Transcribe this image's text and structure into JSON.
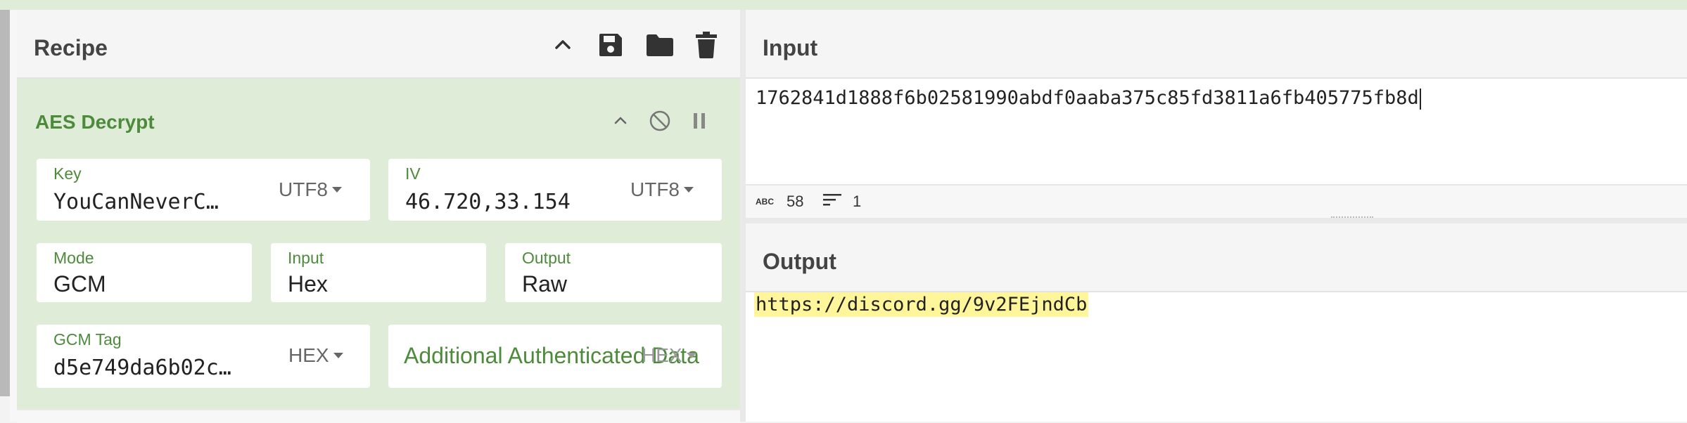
{
  "recipe": {
    "title": "Recipe",
    "icons": [
      "chevron-up-icon",
      "save-icon",
      "folder-icon",
      "trash-icon"
    ]
  },
  "operation": {
    "title": "AES Decrypt",
    "key": {
      "label": "Key",
      "value": "YouCanNeverC…",
      "encoding": "UTF8"
    },
    "iv": {
      "label": "IV",
      "value": "46.720,33.154",
      "encoding": "UTF8"
    },
    "mode": {
      "label": "Mode",
      "value": "GCM"
    },
    "input": {
      "label": "Input",
      "value": "Hex"
    },
    "output": {
      "label": "Output",
      "value": "Raw"
    },
    "gcm_tag": {
      "label": "GCM Tag",
      "value": "d5e749da6b02c…",
      "encoding": "HEX"
    },
    "aad": {
      "label": "Additional Authenticated Data",
      "encoding": "HEX"
    }
  },
  "input_panel": {
    "title": "Input",
    "text": "1762841d1888f6b02581990abdf0aaba375c85fd3811a6fb405775fb8d",
    "stats": {
      "abc_badge": "ABC",
      "length": "58",
      "lines": "1"
    }
  },
  "output_panel": {
    "title": "Output",
    "text": "https://discord.gg/9v2FEjndCb"
  },
  "colors": {
    "accent_green": "#4d8b3b",
    "operation_bg": "#dfecd8",
    "highlight": "#fff59b"
  }
}
